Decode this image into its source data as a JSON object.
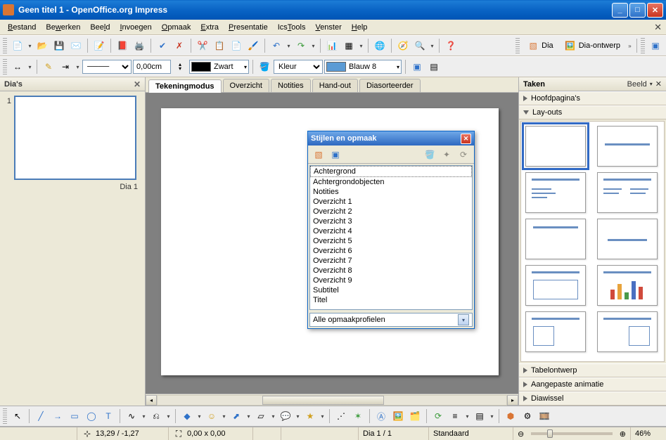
{
  "window": {
    "title": "Geen titel 1 - OpenOffice.org Impress"
  },
  "menubar": {
    "items": [
      {
        "label": "Bestand",
        "u": "B"
      },
      {
        "label": "Bewerken",
        "u": "w"
      },
      {
        "label": "Beeld",
        "u": "l"
      },
      {
        "label": "Invoegen",
        "u": "I"
      },
      {
        "label": "Opmaak",
        "u": "O"
      },
      {
        "label": "Extra",
        "u": "E"
      },
      {
        "label": "Presentatie",
        "u": "P"
      },
      {
        "label": "IcsTools",
        "u": "T"
      },
      {
        "label": "Venster",
        "u": "V"
      },
      {
        "label": "Help",
        "u": "H"
      }
    ]
  },
  "toolbar1_part2": {
    "dia_label": "Dia",
    "dia_ontwerp_label": "Dia-ontwerp"
  },
  "toolbar2": {
    "line_width": "0,00cm",
    "color_name": "Zwart",
    "fill_type": "Kleur",
    "fill_name": "Blauw 8"
  },
  "slides_panel": {
    "title": "Dia's",
    "slides": [
      {
        "num": "1",
        "label": "Dia 1"
      }
    ]
  },
  "tabs": {
    "items": [
      {
        "label": "Tekeningmodus",
        "active": true
      },
      {
        "label": "Overzicht",
        "active": false
      },
      {
        "label": "Notities",
        "active": false
      },
      {
        "label": "Hand-out",
        "active": false
      },
      {
        "label": "Diasorteerder",
        "active": false
      }
    ]
  },
  "styles_window": {
    "title": "Stijlen en opmaak",
    "items": [
      "Achtergrond",
      "Achtergrondobjecten",
      "Notities",
      "Overzicht 1",
      "Overzicht 2",
      "Overzicht 3",
      "Overzicht 4",
      "Overzicht 5",
      "Overzicht 6",
      "Overzicht 7",
      "Overzicht 8",
      "Overzicht 9",
      "Subtitel",
      "Titel"
    ],
    "filter": "Alle opmaakprofielen"
  },
  "task_panel": {
    "title": "Taken",
    "view_label": "Beeld",
    "sections": {
      "master": "Hoofdpagina's",
      "layouts": "Lay-outs",
      "table_design": "Tabelontwerp",
      "custom_anim": "Aangepaste animatie",
      "slide_trans": "Diawissel"
    }
  },
  "statusbar": {
    "pos": "13,29 / -1,27",
    "size": "0,00 x 0,00",
    "slide": "Dia 1 / 1",
    "template": "Standaard",
    "zoom": "46%"
  }
}
